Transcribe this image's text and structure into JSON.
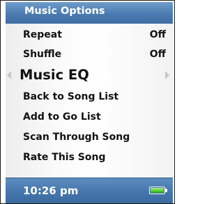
{
  "header": {
    "title": "Music Options"
  },
  "menu": {
    "items": [
      {
        "label": "Repeat",
        "value": "Off"
      },
      {
        "label": "Shuffle",
        "value": "Off"
      },
      {
        "label": "Music EQ"
      },
      {
        "label": "Back to Song List"
      },
      {
        "label": "Add to Go List"
      },
      {
        "label": "Scan Through Song"
      },
      {
        "label": "Rate This Song"
      }
    ],
    "selected_index": 2
  },
  "status": {
    "time": "10:26 pm",
    "battery_level": 1.0,
    "battery_color": "#4fd22f"
  },
  "colors": {
    "bar_blue": "#4a7bb0",
    "selection_arrow": "#c8c8c8"
  }
}
